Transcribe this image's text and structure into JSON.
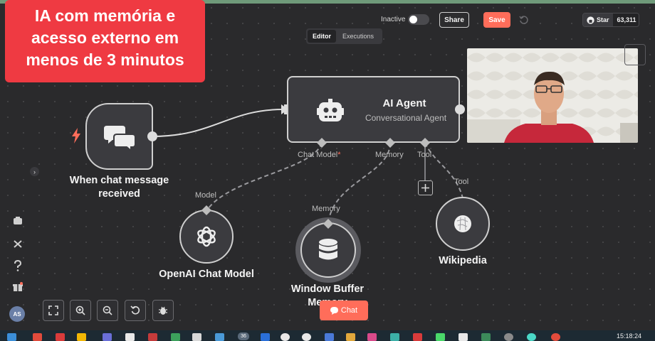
{
  "header": {
    "inactive_label": "Inactive",
    "share_label": "Share",
    "save_label": "Save",
    "github_star_label": "Star",
    "github_star_count": "63,311"
  },
  "tabs": [
    {
      "label": "Editor",
      "active": true
    },
    {
      "label": "Executions",
      "active": false
    }
  ],
  "overlay_title": {
    "lines": [
      "IA com memória e",
      "acesso externo em",
      "menos de 3 minutos"
    ]
  },
  "sidebar": {
    "avatar_initials": "AS",
    "expand_glyph": "›"
  },
  "nodes": {
    "trigger": {
      "label_line1": "When chat message",
      "label_line2": "received"
    },
    "agent": {
      "title": "AI Agent",
      "subtitle": "Conversational Agent",
      "inputs": {
        "chat_model": "Chat Model",
        "required_mark": "*",
        "memory": "Memory",
        "tool": "Tool"
      }
    },
    "openai": {
      "label": "OpenAI Chat Model",
      "port_label": "Model"
    },
    "memory": {
      "label_line1": "Window Buffer",
      "label_line2": "Memory",
      "port_label": "Memory"
    },
    "wikipedia": {
      "label": "Wikipedia",
      "port_label": "Tool"
    }
  },
  "bottom": {
    "chat_label": "Chat"
  },
  "taskbar": {
    "clock": "15:18:24",
    "badge_count": "36"
  },
  "colors": {
    "accent": "#ff6d5a",
    "overlay_red": "#ef3a42",
    "node_bg": "#3b3b3f",
    "canvas_bg": "#2a2a2c"
  }
}
